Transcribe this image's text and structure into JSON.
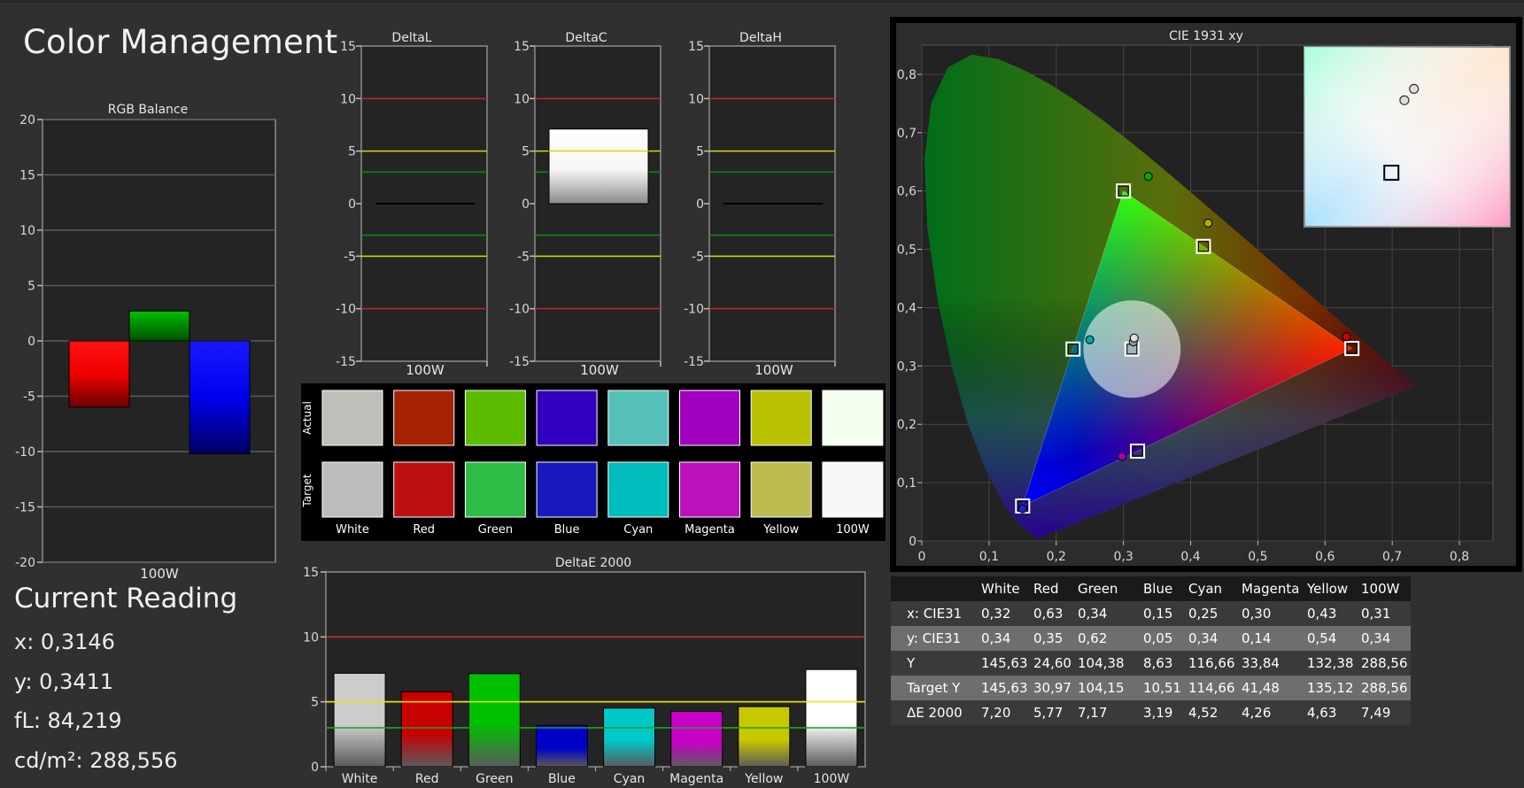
{
  "title": "Color Management",
  "current_reading": {
    "heading": "Current Reading",
    "lines": [
      "x: 0,3146",
      "y: 0,3411",
      "fL: 84,219",
      "cd/m²: 288,556"
    ]
  },
  "chart_data": [
    {
      "id": "rgb-balance",
      "type": "bar",
      "title": "RGB Balance",
      "categories": [
        "100W"
      ],
      "ylim": [
        -20,
        20
      ],
      "yticks": [
        "20",
        "15",
        "10",
        "5",
        "0",
        "-5",
        "-10",
        "-15",
        "-20"
      ],
      "series": [
        {
          "color": "#ff0000",
          "values": [
            -6.0
          ]
        },
        {
          "color": "#00aa00",
          "values": [
            2.7
          ]
        },
        {
          "color": "#0000ff",
          "values": [
            -10.2
          ]
        }
      ]
    },
    {
      "id": "delta-l",
      "type": "bar",
      "title": "DeltaL",
      "categories": [
        "100W"
      ],
      "values": [
        0.0
      ],
      "ylim": [
        -15,
        15
      ],
      "yticks": [
        "15",
        "10",
        "5",
        "0",
        "-5",
        "-10",
        "-15"
      ],
      "reference_lines": [
        {
          "y": 10,
          "color": "#d02020"
        },
        {
          "y": 5,
          "color": "#d8d800"
        },
        {
          "y": 3,
          "color": "#108810"
        },
        {
          "y": -3,
          "color": "#108810"
        },
        {
          "y": -5,
          "color": "#d8d800"
        },
        {
          "y": -10,
          "color": "#d02020"
        }
      ]
    },
    {
      "id": "delta-c",
      "type": "bar",
      "title": "DeltaC",
      "categories": [
        "100W"
      ],
      "values": [
        7.1
      ],
      "ylim": [
        -15,
        15
      ],
      "yticks": [
        "15",
        "10",
        "5",
        "0",
        "-5",
        "-10",
        "-15"
      ],
      "reference_lines": [
        {
          "y": 10,
          "color": "#d02020"
        },
        {
          "y": 5,
          "color": "#d8d800"
        },
        {
          "y": 3,
          "color": "#108810"
        },
        {
          "y": -3,
          "color": "#108810"
        },
        {
          "y": -5,
          "color": "#d8d800"
        },
        {
          "y": -10,
          "color": "#d02020"
        }
      ]
    },
    {
      "id": "delta-h",
      "type": "bar",
      "title": "DeltaH",
      "categories": [
        "100W"
      ],
      "values": [
        0.0
      ],
      "ylim": [
        -15,
        15
      ],
      "yticks": [
        "15",
        "10",
        "5",
        "0",
        "-5",
        "-10",
        "-15"
      ],
      "reference_lines": [
        {
          "y": 10,
          "color": "#d02020"
        },
        {
          "y": 5,
          "color": "#d8d800"
        },
        {
          "y": 3,
          "color": "#108810"
        },
        {
          "y": -3,
          "color": "#108810"
        },
        {
          "y": -5,
          "color": "#d8d800"
        },
        {
          "y": -10,
          "color": "#d02020"
        }
      ]
    },
    {
      "id": "swatches",
      "type": "table",
      "row_labels": [
        "Actual",
        "Target"
      ],
      "categories": [
        "White",
        "Red",
        "Green",
        "Blue",
        "Cyan",
        "Magenta",
        "Yellow",
        "100W"
      ],
      "actual_colors": [
        "#bcc0b8",
        "#a42200",
        "#5cbc00",
        "#3300c0",
        "#54c0b8",
        "#a200c0",
        "#b8c200",
        "#f4fff0"
      ],
      "target_colors": [
        "#bcbcbc",
        "#bc1010",
        "#2ebe48",
        "#1818c0",
        "#00bcbc",
        "#bc10bc",
        "#bcbc50",
        "#f8f8f8"
      ]
    },
    {
      "id": "delta-e-2000",
      "type": "bar",
      "title": "DeltaE 2000",
      "categories": [
        "White",
        "Red",
        "Green",
        "Blue",
        "Cyan",
        "Magenta",
        "Yellow",
        "100W"
      ],
      "values": [
        7.2,
        5.77,
        7.17,
        3.19,
        4.52,
        4.26,
        4.63,
        7.49
      ],
      "colors": [
        "#cccccc",
        "#c80000",
        "#00c000",
        "#0000c8",
        "#00c8c8",
        "#c800c8",
        "#c8c800",
        "#ffffff"
      ],
      "ylim": [
        0,
        15
      ],
      "yticks": [
        "15",
        "10",
        "5",
        "0"
      ],
      "reference_lines": [
        {
          "y": 10,
          "color": "#e03030"
        },
        {
          "y": 5,
          "color": "#e8e800"
        },
        {
          "y": 3,
          "color": "#20a020"
        }
      ]
    },
    {
      "id": "cie-1931",
      "type": "scatter",
      "title": "CIE 1931 xy",
      "xlim": [
        0,
        0.85
      ],
      "ylim": [
        0,
        0.85
      ],
      "xticks": [
        "0",
        "0,1",
        "0,2",
        "0,3",
        "0,4",
        "0,5",
        "0,6",
        "0,7",
        "0,8"
      ],
      "yticks": [
        "0",
        "0,1",
        "0,2",
        "0,3",
        "0,4",
        "0,5",
        "0,6",
        "0,7",
        "0,8"
      ],
      "target_gamut": [
        [
          0.64,
          0.33
        ],
        [
          0.3,
          0.6
        ],
        [
          0.15,
          0.06
        ]
      ],
      "targets": [
        {
          "x": 0.3127,
          "y": 0.329
        },
        {
          "x": 0.64,
          "y": 0.33
        },
        {
          "x": 0.3,
          "y": 0.6
        },
        {
          "x": 0.15,
          "y": 0.06
        },
        {
          "x": 0.225,
          "y": 0.329
        },
        {
          "x": 0.321,
          "y": 0.154
        },
        {
          "x": 0.419,
          "y": 0.505
        }
      ],
      "measured": [
        {
          "x": 0.3146,
          "y": 0.3411,
          "color": "#999999"
        },
        {
          "x": 0.632,
          "y": 0.35,
          "color": "#cc0000"
        },
        {
          "x": 0.337,
          "y": 0.625,
          "color": "#00aa00"
        },
        {
          "x": 0.15,
          "y": 0.055,
          "color": "#2020cc"
        },
        {
          "x": 0.25,
          "y": 0.345,
          "color": "#00aaaa"
        },
        {
          "x": 0.298,
          "y": 0.145,
          "color": "#aa00aa"
        },
        {
          "x": 0.426,
          "y": 0.545,
          "color": "#aaaa00"
        },
        {
          "x": 0.316,
          "y": 0.348,
          "color": "#dddddd"
        }
      ],
      "inset": {
        "xlim": [
          0.3,
          0.33
        ],
        "ylim": [
          0.32,
          0.35
        ],
        "target": {
          "x": 0.3127,
          "y": 0.329
        },
        "measured": [
          {
            "x": 0.3146,
            "y": 0.3411
          },
          {
            "x": 0.316,
            "y": 0.343
          }
        ]
      }
    }
  ],
  "table": {
    "columns": [
      "",
      "White",
      "Red",
      "Green",
      "Blue",
      "Cyan",
      "Magenta",
      "Yellow",
      "100W"
    ],
    "rows": [
      {
        "label": "x: CIE31",
        "values": [
          "0,32",
          "0,63",
          "0,34",
          "0,15",
          "0,25",
          "0,30",
          "0,43",
          "0,31"
        ]
      },
      {
        "label": "y: CIE31",
        "values": [
          "0,34",
          "0,35",
          "0,62",
          "0,05",
          "0,34",
          "0,14",
          "0,54",
          "0,34"
        ]
      },
      {
        "label": "Y",
        "values": [
          "145,63",
          "24,60",
          "104,38",
          "8,63",
          "116,66",
          "33,84",
          "132,38",
          "288,56"
        ]
      },
      {
        "label": "Target Y",
        "values": [
          "145,63",
          "30,97",
          "104,15",
          "10,51",
          "114,66",
          "41,48",
          "135,12",
          "288,56"
        ]
      },
      {
        "label": "ΔE 2000",
        "values": [
          "7,20",
          "5,77",
          "7,17",
          "3,19",
          "4,52",
          "4,26",
          "4,63",
          "7,49"
        ]
      }
    ]
  }
}
